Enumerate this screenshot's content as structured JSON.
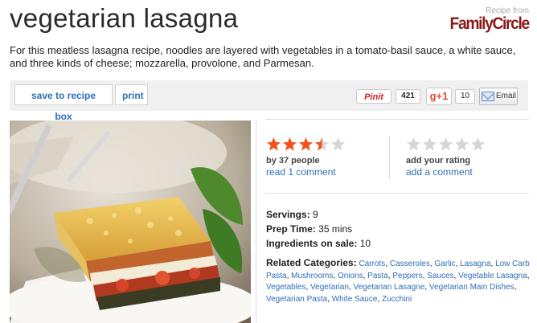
{
  "recipe": {
    "title": "vegetarian lasagna",
    "description": "For this meatless lasagna recipe, noodles are layered with vegetables in a tomato-basil sauce, a white sauce, and three kinds of cheese; mozzarella, provolone, and Parmesan."
  },
  "brand": {
    "small_text": "Recipe from",
    "logo_text": "FamilyCircle"
  },
  "toolbar": {
    "save_label": "save to recipe box",
    "print_label": "print",
    "pinit_label": "Pinit",
    "pin_count": "421",
    "gplus_label": "g+1",
    "gplus_count": "10",
    "email_label": "Email"
  },
  "rating": {
    "value": 3.5,
    "max": 5,
    "by_text": "by  37 people",
    "comment_link": "read 1 comment",
    "your_rating_label": "add your rating",
    "add_comment_link": "add a comment",
    "your_rating_value": 0
  },
  "facts": {
    "servings_label": "Servings:",
    "servings_value": "9",
    "prep_label": "Prep Time:",
    "prep_value": "35 mins",
    "sale_label": "Ingredients on sale:",
    "sale_value": "10"
  },
  "categories": {
    "label": "Related Categories:",
    "items": [
      "Carrots",
      "Casseroles",
      "Garlic",
      "Lasagna",
      "Low Carb Pasta",
      "Mushrooms",
      "Onions",
      "Pasta",
      "Peppers",
      "Sauces",
      "Vegetable Lasagna",
      "Vegetables",
      "Vegetarian",
      "Vegetarian Lasagne",
      "Vegetarian Main Dishes",
      "Vegetarian Pasta",
      "White Sauce",
      "Zucchini"
    ]
  },
  "colors": {
    "star_on": "#f4511e",
    "star_off": "#d6d6d6",
    "link": "#2d6fb7",
    "brand": "#8b1b1b"
  }
}
